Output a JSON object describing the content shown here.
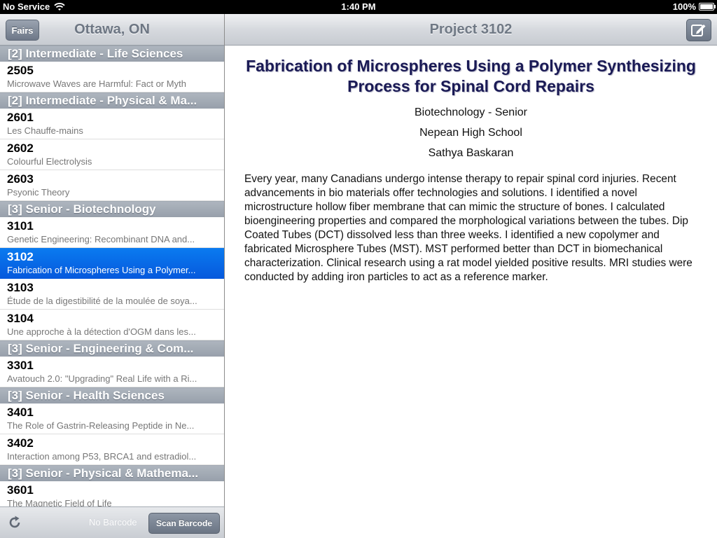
{
  "status_bar": {
    "carrier": "No Service",
    "time": "1:40 PM",
    "battery": "100%"
  },
  "master": {
    "nav_title": "Ottawa, ON",
    "back_label": "Fairs",
    "sections": [
      {
        "header": "[2] Intermediate - Life Sciences",
        "rows": [
          {
            "number": "2505",
            "title": "Microwave Waves are Harmful: Fact or Myth",
            "selected": false
          }
        ]
      },
      {
        "header": "[2] Intermediate - Physical & Ma...",
        "rows": [
          {
            "number": "2601",
            "title": "Les Chauffe-mains",
            "selected": false
          },
          {
            "number": "2602",
            "title": "Colourful Electrolysis",
            "selected": false
          },
          {
            "number": "2603",
            "title": "Psyonic Theory",
            "selected": false
          }
        ]
      },
      {
        "header": "[3] Senior - Biotechnology",
        "rows": [
          {
            "number": "3101",
            "title": "Genetic Engineering: Recombinant DNA and...",
            "selected": false
          },
          {
            "number": "3102",
            "title": "Fabrication of Microspheres Using a Polymer...",
            "selected": true
          },
          {
            "number": "3103",
            "title": "Étude de la digestibilité de la moulée de soya...",
            "selected": false
          },
          {
            "number": "3104",
            "title": "Une approche à la détection d'OGM dans les...",
            "selected": false
          }
        ]
      },
      {
        "header": "[3] Senior - Engineering & Com...",
        "rows": [
          {
            "number": "3301",
            "title": "Avatouch 2.0: \"Upgrading\" Real Life with a Ri...",
            "selected": false
          }
        ]
      },
      {
        "header": "[3] Senior - Health Sciences",
        "rows": [
          {
            "number": "3401",
            "title": "The Role of Gastrin-Releasing Peptide in Ne...",
            "selected": false
          },
          {
            "number": "3402",
            "title": "Interaction among P53, BRCA1 and estradiol...",
            "selected": false
          }
        ]
      },
      {
        "header": "[3] Senior - Physical & Mathema...",
        "rows": [
          {
            "number": "3601",
            "title": "The Magnetic Field of Life",
            "selected": false
          }
        ]
      }
    ],
    "toolbar": {
      "refresh_icon": "refresh-icon",
      "barcode_status": "No Barcode",
      "scan_label": "Scan Barcode"
    }
  },
  "detail": {
    "nav_title": "Project 3102",
    "compose_icon": "compose-icon",
    "project_title": "Fabrication of Microspheres Using a Polymer Synthesizing Process for Spinal Cord Repairs",
    "category": "Biotechnology - Senior",
    "school": "Nepean High School",
    "student": "Sathya Baskaran",
    "abstract": "Every year, many Canadians undergo intense therapy to repair spinal cord injuries. Recent advancements in bio materials offer technologies and solutions. I identified a novel microstructure hollow fiber membrane that can mimic the structure of bones. I calculated bioengineering properties and compared the morphological variations between the tubes. Dip Coated Tubes (DCT) dissolved less than three weeks.  I identified a new copolymer and fabricated Microsphere Tubes (MST). MST performed better than DCT in biomechanical characterization. Clinical research using a rat model yielded positive results. MRI studies were conducted  by adding iron particles to act as a reference marker."
  },
  "colors": {
    "selection": "#0a6ae8",
    "section_header": "#a3abb5",
    "title_text": "#1a1a55"
  }
}
